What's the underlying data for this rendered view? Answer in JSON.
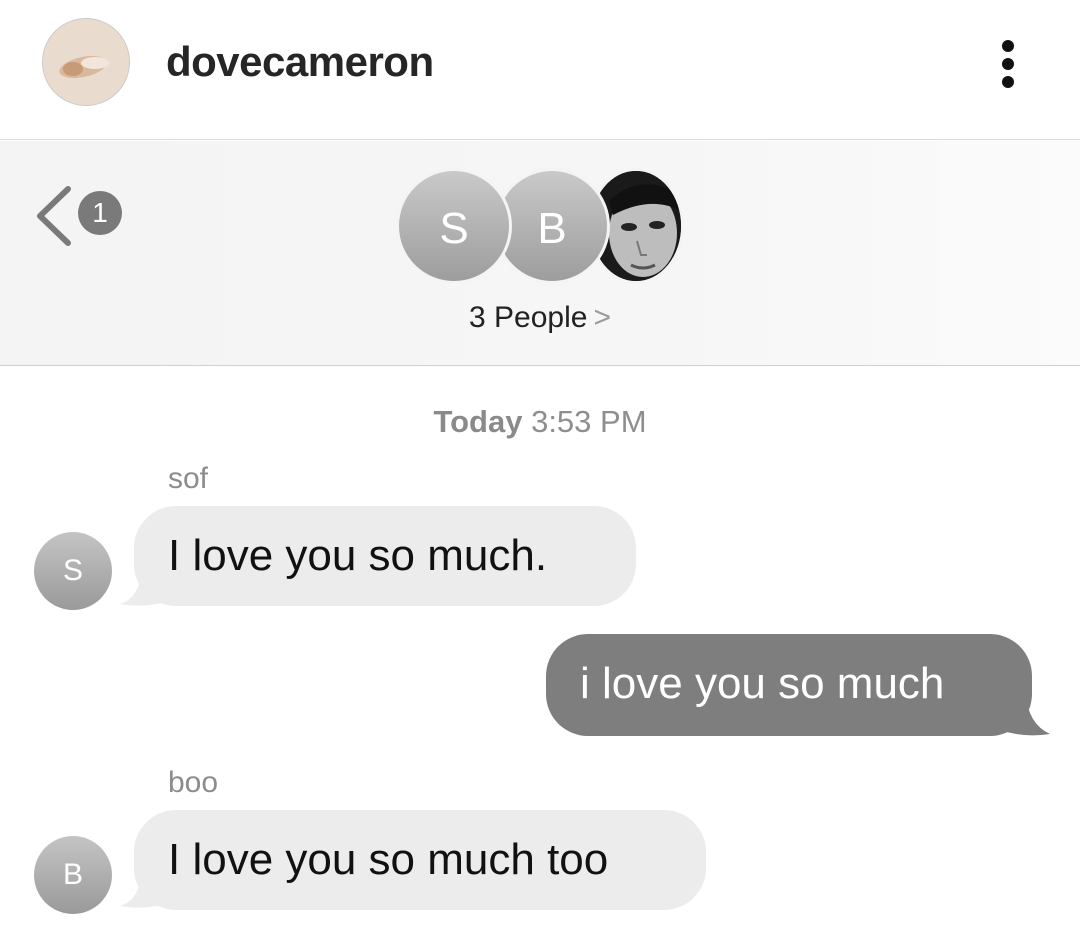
{
  "post_header": {
    "username": "dovecameron",
    "more_icon": "more-vertical-icon"
  },
  "messages_header": {
    "back_icon": "chevron-left-icon",
    "unread_count": "1",
    "participants": [
      "S",
      "B"
    ],
    "participants_label": "3 People",
    "participants_chevron": ">"
  },
  "conversation": {
    "timestamp_day": "Today",
    "timestamp_time": "3:53 PM",
    "messages": [
      {
        "sender": "sof",
        "avatar": "S",
        "text": "I love you so much.",
        "direction": "incoming"
      },
      {
        "sender": "",
        "avatar": "",
        "text": "i love you so much",
        "direction": "outgoing"
      },
      {
        "sender": "boo",
        "avatar": "B",
        "text": "I love you so much too",
        "direction": "incoming"
      }
    ]
  },
  "colors": {
    "incoming_bubble": "#ececec",
    "outgoing_bubble": "#7e7e7e",
    "avatar_gray": "#a8a8a8"
  }
}
